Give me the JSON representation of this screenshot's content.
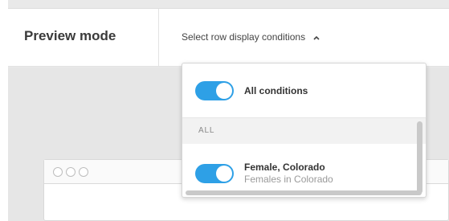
{
  "header": {
    "title": "Preview mode",
    "selector_label": "Select row display conditions",
    "selector_icon": "chevron-up-icon"
  },
  "dropdown": {
    "all_conditions": {
      "label": "All conditions",
      "enabled": true
    },
    "section_label": "ALL",
    "items": [
      {
        "label": "Female, Colorado",
        "sublabel": "Females in Colorado",
        "enabled": true
      }
    ]
  },
  "colors": {
    "toggle_on": "#2ea0e6",
    "background": "#e9e9e9"
  }
}
